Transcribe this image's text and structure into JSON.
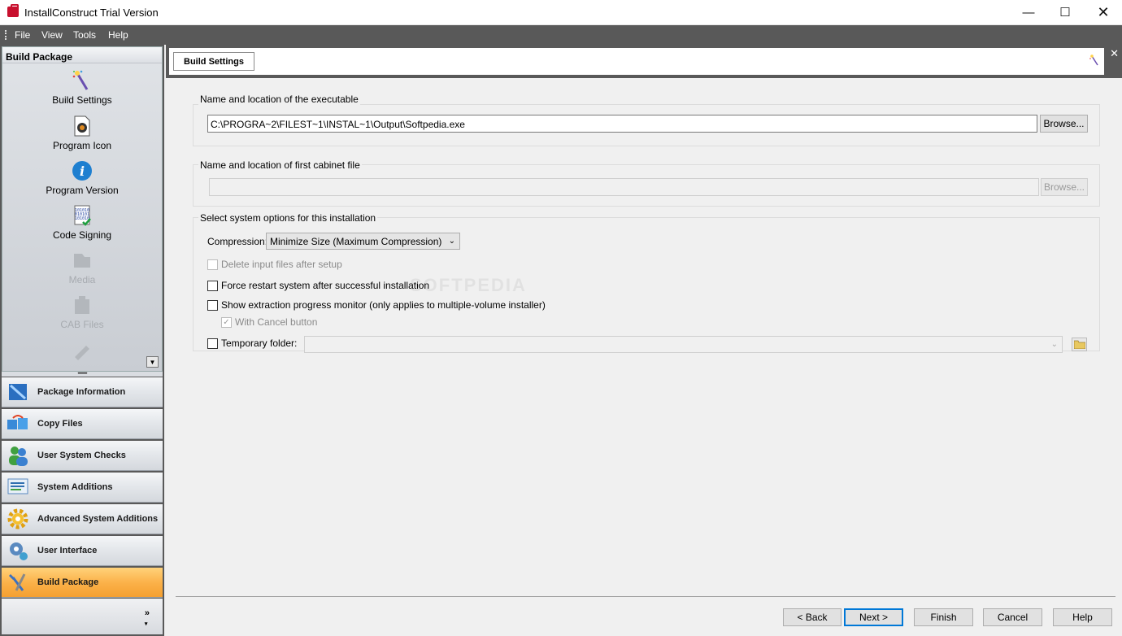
{
  "window": {
    "title": "InstallConstruct Trial Version",
    "controls": [
      "minimize",
      "maximize",
      "close"
    ]
  },
  "menu": [
    "File",
    "View",
    "Tools",
    "Help"
  ],
  "left_pane": {
    "section_title": "Build Package",
    "items": [
      {
        "label": "Build Settings",
        "icon": "magic-wand-icon",
        "enabled": true
      },
      {
        "label": "Program Icon",
        "icon": "program-icon",
        "enabled": true
      },
      {
        "label": "Program Version",
        "icon": "info-icon",
        "enabled": true
      },
      {
        "label": "Code Signing",
        "icon": "binary-document-icon",
        "enabled": true
      },
      {
        "label": "Media",
        "icon": "media-icon",
        "enabled": false
      },
      {
        "label": "CAB Files",
        "icon": "cab-files-icon",
        "enabled": false
      }
    ],
    "nav": [
      {
        "label": "Package Information",
        "icon": "package-icon",
        "active": false
      },
      {
        "label": "Copy Files",
        "icon": "copy-files-icon",
        "active": false
      },
      {
        "label": "User System Checks",
        "icon": "users-icon",
        "active": false
      },
      {
        "label": "System Additions",
        "icon": "system-additions-icon",
        "active": false
      },
      {
        "label": "Advanced System Additions",
        "icon": "gear-icon",
        "active": false
      },
      {
        "label": "User Interface",
        "icon": "user-interface-icon",
        "active": false
      },
      {
        "label": "Build Package",
        "icon": "tools-icon",
        "active": true
      }
    ]
  },
  "tab": {
    "label": "Build Settings"
  },
  "executable_group": {
    "label": "Name and location of the executable",
    "path": "C:\\PROGRA~2\\FILEST~1\\INSTAL~1\\Output\\Softpedia.exe",
    "browse": "Browse..."
  },
  "cabinet_group": {
    "label": "Name and location of first cabinet file",
    "path": "",
    "browse": "Browse..."
  },
  "options_group": {
    "label": "Select system options for this installation",
    "compression_label": "Compression:",
    "compression_value": "Minimize Size (Maximum Compression)",
    "checkboxes": [
      {
        "label": "Delete input files after setup",
        "checked": false,
        "enabled": false
      },
      {
        "label": "Force restart system after successful installation",
        "checked": false,
        "enabled": true
      },
      {
        "label": "Show extraction progress monitor (only applies to multiple-volume installer)",
        "checked": false,
        "enabled": true
      },
      {
        "label": "With Cancel button",
        "checked": true,
        "enabled": false
      }
    ],
    "temp_folder_label": "Temporary folder:",
    "temp_folder_value": ""
  },
  "buttons": {
    "back": "< Back",
    "next": "Next >",
    "finish": "Finish",
    "cancel": "Cancel",
    "help": "Help"
  }
}
